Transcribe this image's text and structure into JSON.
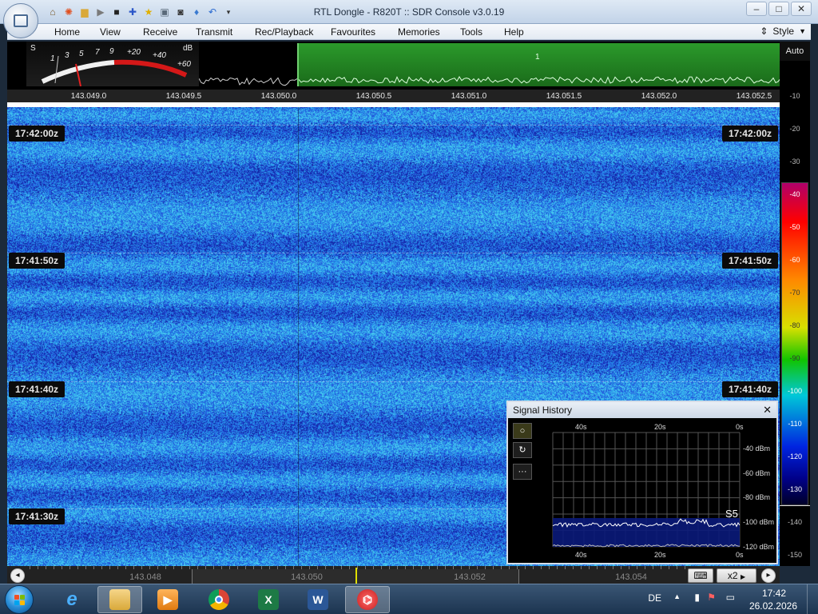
{
  "window": {
    "title": "RTL Dongle - R820T :: SDR Console v3.0.19",
    "controls": [
      "–",
      "□",
      "✕"
    ]
  },
  "menu": {
    "items": [
      "Home",
      "View",
      "Receive",
      "Transmit",
      "Rec/Playback",
      "Favourites",
      "Memories",
      "Tools",
      "Help"
    ],
    "style_label": "Style"
  },
  "smeter": {
    "s_label": "S",
    "db_label": "dB",
    "s_scale": [
      "1",
      "3",
      "5",
      "7",
      "9"
    ],
    "db_scale": [
      "+20",
      "+40",
      "+60"
    ]
  },
  "spectrum": {
    "channel_label": "1",
    "freq_ticks": [
      "143.049.0",
      "143.049.5",
      "143.050.0",
      "143.050.5",
      "143.051.0",
      "143.051.5",
      "143.052.0",
      "143.052.5"
    ]
  },
  "waterfall": {
    "time_labels": [
      "17:42:00z",
      "17:41:50z",
      "17:41:40z",
      "17:41:30z"
    ]
  },
  "scale": {
    "auto_label": "Auto",
    "ticks": [
      "-10",
      "-20",
      "-30",
      "-40",
      "-50",
      "-60",
      "-70",
      "-80",
      "-90",
      "-100",
      "-110",
      "-120",
      "-130",
      "-140",
      "-150"
    ],
    "colors": {
      "high": "#ff0000",
      "mid": "#11c400",
      "low": "#0024e0"
    }
  },
  "band": {
    "labels": [
      "143.048",
      "143.050",
      "143.052",
      "143.054"
    ],
    "zoom_label": "x2"
  },
  "signal_history": {
    "title": "Signal History",
    "top_time_labels": [
      "40s",
      "20s",
      "0s"
    ],
    "bottom_time_labels": [
      "40s",
      "20s",
      "0s"
    ],
    "dbm_labels": [
      "-40 dBm",
      "-60 dBm",
      "-80 dBm",
      "-100 dBm",
      "-120 dBm"
    ],
    "s_reading": "S5",
    "buttons": [
      "○",
      "↻",
      "···"
    ]
  },
  "taskbar": {
    "language": "DE",
    "time": "17:42",
    "date": "26.02.2026",
    "apps": [
      "internet-explorer",
      "file-explorer",
      "media-player",
      "chrome",
      "excel",
      "word",
      "sdr-console"
    ]
  }
}
